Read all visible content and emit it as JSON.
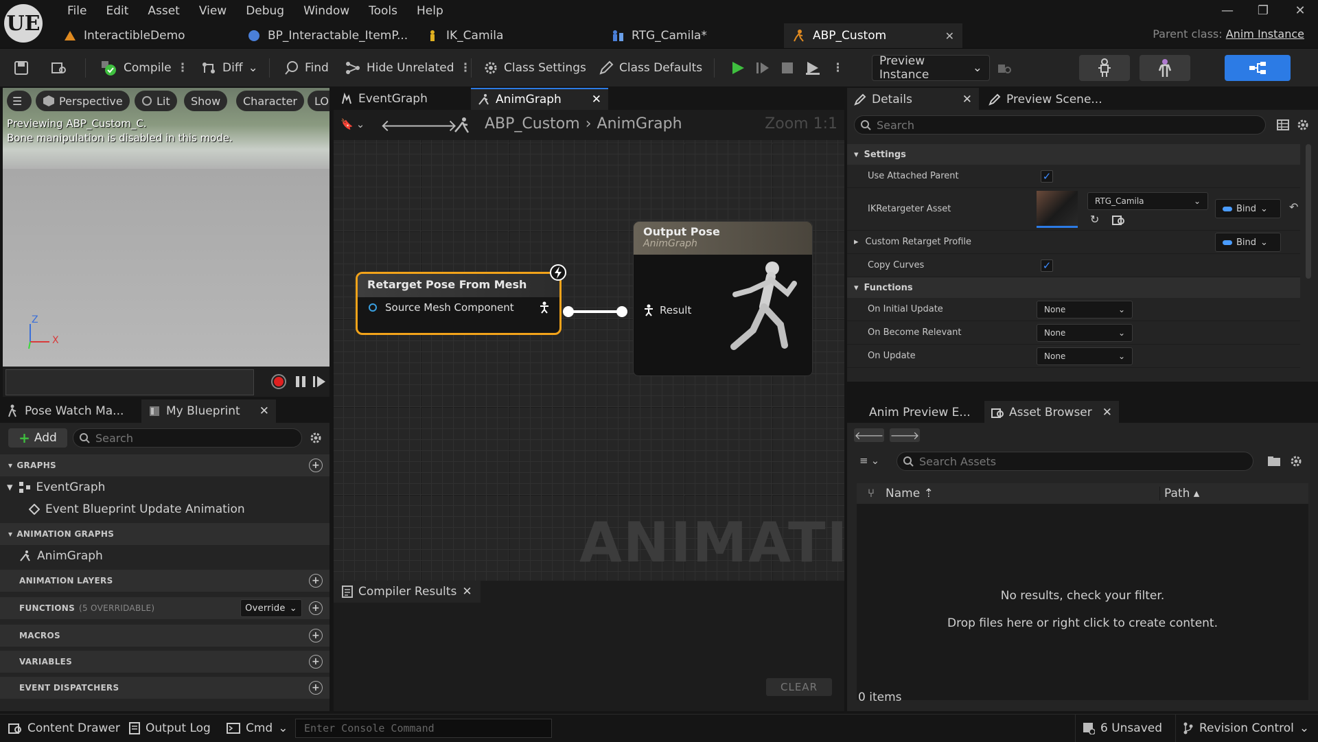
{
  "logo": "UE",
  "menu": [
    "File",
    "Edit",
    "Asset",
    "View",
    "Debug",
    "Window",
    "Tools",
    "Help"
  ],
  "doc_tabs": [
    {
      "label": "InteractibleDemo",
      "icon": "level-icon",
      "color": "#e08a20"
    },
    {
      "label": "BP_Interactable_ItemP...",
      "icon": "blueprint-icon",
      "color": "#4a7fd8"
    },
    {
      "label": "IK_Camila",
      "icon": "ik-rig-icon",
      "color": "#e0b020"
    },
    {
      "label": "RTG_Camila*",
      "icon": "retargeter-icon",
      "color": "#4a7fd8"
    },
    {
      "label": "ABP_Custom",
      "icon": "anim-blueprint-icon",
      "color": "#e08a20"
    }
  ],
  "parent_class": {
    "label": "Parent class:",
    "value": "Anim Instance"
  },
  "toolbar": {
    "compile": "Compile",
    "diff": "Diff",
    "find": "Find",
    "hide_unrelated": "Hide Unrelated",
    "class_settings": "Class Settings",
    "class_defaults": "Class Defaults",
    "preview_instance": "Preview Instance"
  },
  "viewport": {
    "perspective": "Perspective",
    "lit": "Lit",
    "show": "Show",
    "character": "Character",
    "lod": "LOI",
    "message_line1": "Previewing ABP_Custom_C.",
    "message_line2": "Bone manipulation is disabled in this mode.",
    "axis_z": "Z",
    "axis_x": "X"
  },
  "graph": {
    "tabs": [
      "EventGraph",
      "AnimGraph"
    ],
    "breadcrumb": [
      "ABP_Custom",
      "AnimGraph"
    ],
    "zoom": "Zoom 1:1",
    "watermark": "ANIMATION",
    "node_retarget": {
      "title": "Retarget Pose From Mesh",
      "pin": "Source Mesh Component"
    },
    "node_output": {
      "title": "Output Pose",
      "subtitle": "AnimGraph",
      "pin": "Result"
    }
  },
  "compiler": {
    "tab": "Compiler Results",
    "clear": "CLEAR"
  },
  "my_blueprint": {
    "tabs": [
      "Pose Watch Ma...",
      "My Blueprint"
    ],
    "add": "Add",
    "search_placeholder": "Search",
    "sections": {
      "graphs": "GRAPHS",
      "event_graph": "EventGraph",
      "event_update": "Event Blueprint Update Animation",
      "animation_graphs": "ANIMATION GRAPHS",
      "anim_graph": "AnimGraph",
      "animation_layers": "ANIMATION LAYERS",
      "functions": "FUNCTIONS",
      "functions_note": "(5 OVERRIDABLE)",
      "override": "Override",
      "macros": "MACROS",
      "variables": "VARIABLES",
      "event_dispatchers": "EVENT DISPATCHERS"
    }
  },
  "details": {
    "tabs": [
      "Details",
      "Preview Scene..."
    ],
    "search_placeholder": "Search",
    "settings": "Settings",
    "use_attached_parent": "Use Attached Parent",
    "use_attached_parent_checked": true,
    "ikretargeter_asset": "IKRetargeter Asset",
    "ikretargeter_value": "RTG_Camila",
    "bind": "Bind",
    "custom_retarget_profile": "Custom Retarget Profile",
    "copy_curves": "Copy Curves",
    "copy_curves_checked": true,
    "functions": "Functions",
    "on_initial_update": "On Initial Update",
    "on_become_relevant": "On Become Relevant",
    "on_update": "On Update",
    "none": "None"
  },
  "asset_browser": {
    "tabs": [
      "Anim Preview E...",
      "Asset Browser"
    ],
    "search_placeholder": "Search Assets",
    "col_name": "Name",
    "col_path": "Path",
    "empty1": "No results, check your filter.",
    "empty2": "Drop files here or right click to create content.",
    "count": "0 items"
  },
  "statusbar": {
    "content_drawer": "Content Drawer",
    "output_log": "Output Log",
    "cmd": "Cmd",
    "console_placeholder": "Enter Console Command",
    "unsaved": "6 Unsaved",
    "revision_control": "Revision Control"
  },
  "colors": {
    "accent": "#2c7be5",
    "node_border": "#f2a31a",
    "play_green": "#3fbf3f"
  }
}
